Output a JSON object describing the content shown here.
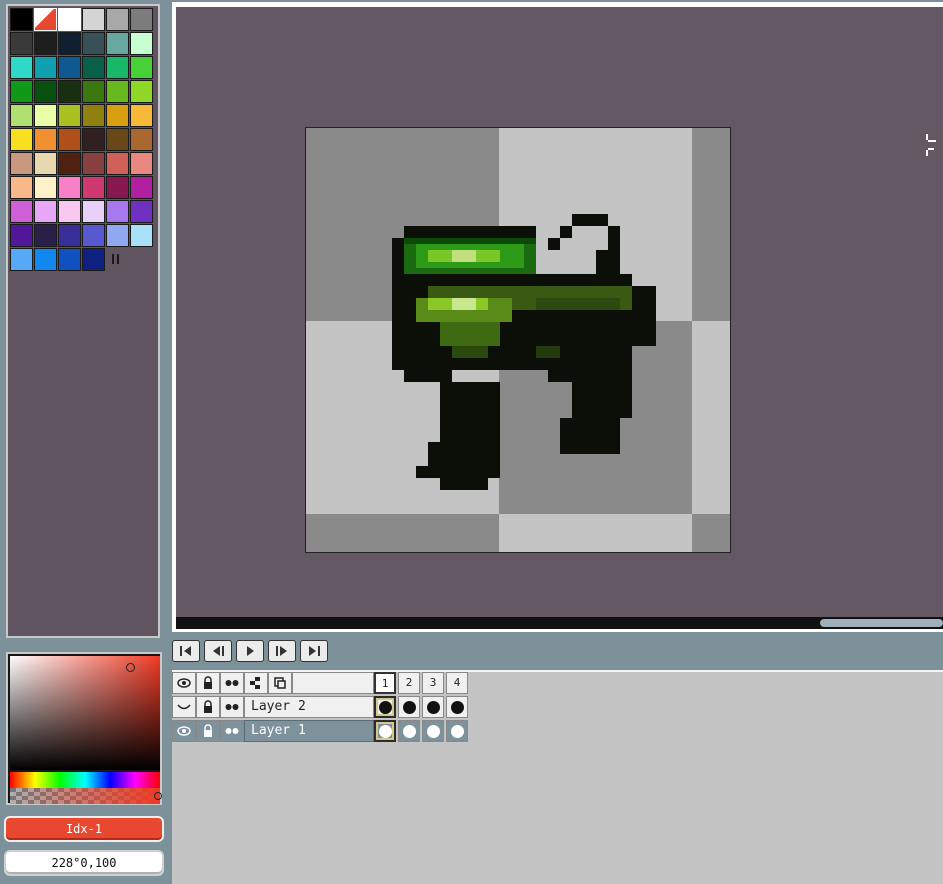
{
  "palette": {
    "colors": [
      "#000000",
      "#e84830",
      "#ffffff",
      "#d4d4d4",
      "#a8a8a8",
      "#7c7c7c",
      "#3a3a3a",
      "#1e1e1e",
      "#102030",
      "#385058",
      "#68a8a0",
      "#c8ffd0",
      "#30d8c8",
      "#10a0b0",
      "#105890",
      "#086048",
      "#18b868",
      "#48d038",
      "#109818",
      "#085010",
      "#183010",
      "#3c7810",
      "#68b820",
      "#90d828",
      "#b0e070",
      "#e8ffa8",
      "#a8c020",
      "#908010",
      "#d8a010",
      "#f8b838",
      "#f8e020",
      "#f09030",
      "#b05018",
      "#302020",
      "#684818",
      "#a86830",
      "#c89880",
      "#e8d8b0",
      "#502010",
      "#884040",
      "#d06058",
      "#e88880",
      "#f8b888",
      "#fff0c8",
      "#f880c8",
      "#d03870",
      "#881850",
      "#b020a0",
      "#d060d8",
      "#e8a8f8",
      "#f8c8f0",
      "#e8d0f8",
      "#a878f0",
      "#7030c0",
      "#501898",
      "#282048",
      "#383098",
      "#5858d0",
      "#90a8f0",
      "#a8e0f8",
      "#58a8f8",
      "#1088f0",
      "#1050c0",
      "#102080"
    ]
  },
  "color_picker": {
    "current_color": "#f03a24"
  },
  "index_field": {
    "value": "Idx-1"
  },
  "info_field": {
    "value": "228°0,100"
  },
  "timeline": {
    "frames": [
      "1",
      "2",
      "3",
      "4"
    ],
    "current_frame": "1",
    "layers": [
      {
        "name": "Layer 2",
        "visible": false,
        "cels": [
          "dark",
          "dark",
          "dark",
          "dark"
        ]
      },
      {
        "name": "Layer 1",
        "visible": true,
        "selected": true,
        "cels": [
          "light",
          "light",
          "light",
          "light"
        ]
      }
    ]
  },
  "icons": {
    "visibility": "eye-icon",
    "lock": "lock-icon",
    "continuous": "link-dots-icon",
    "group": "group-layers-icon",
    "new_layer": "new-layer-icon",
    "crosshair": "crosshair-icon"
  },
  "colors": {
    "canvas_bg": "#645864",
    "ui_bg": "#7d919b",
    "selection": "#7e929c"
  }
}
